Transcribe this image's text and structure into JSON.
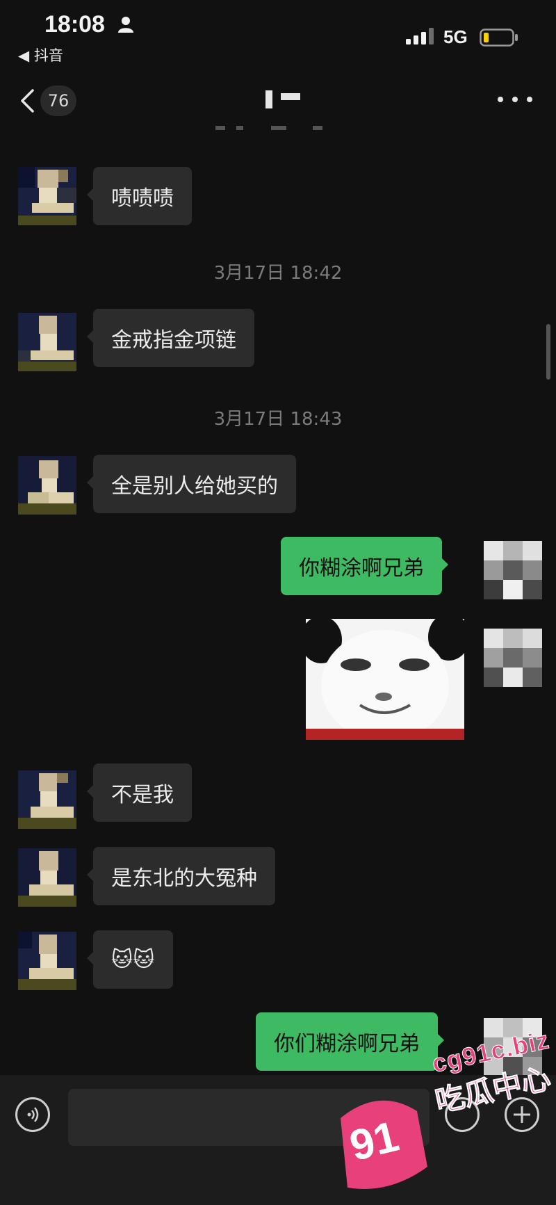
{
  "status_bar": {
    "time": "18:08",
    "return_app": "◀ 抖音",
    "network": "5G"
  },
  "nav": {
    "unread_count": "76",
    "chat_title": "",
    "back_icon": "chevron-left-icon",
    "more_icon": "ellipsis-icon"
  },
  "messages": [
    {
      "side": "in",
      "text": "啧啧啧"
    },
    {
      "timestamp": "3月17日 18:42"
    },
    {
      "side": "in",
      "text": "金戒指金项链"
    },
    {
      "timestamp": "3月17日 18:43"
    },
    {
      "side": "in",
      "text": "全是别人给她买的"
    },
    {
      "side": "out",
      "text": "你糊涂啊兄弟"
    },
    {
      "side": "out",
      "sticker": "panda-face-sticker"
    },
    {
      "side": "in",
      "text": "不是我"
    },
    {
      "side": "in",
      "text": "是东北的大冤种"
    },
    {
      "side": "in",
      "emoji": "🐱🐱"
    },
    {
      "side": "out",
      "text": "你们糊涂啊兄弟"
    }
  ],
  "input": {
    "placeholder": ""
  },
  "watermark": {
    "url": "cg91c.biz",
    "name": "吃瓜中心",
    "logo": "91"
  },
  "colors": {
    "background": "#111111",
    "incoming_bubble": "#2c2c2c",
    "outgoing_bubble": "#3ebb62",
    "watermark": "#e8407a"
  }
}
